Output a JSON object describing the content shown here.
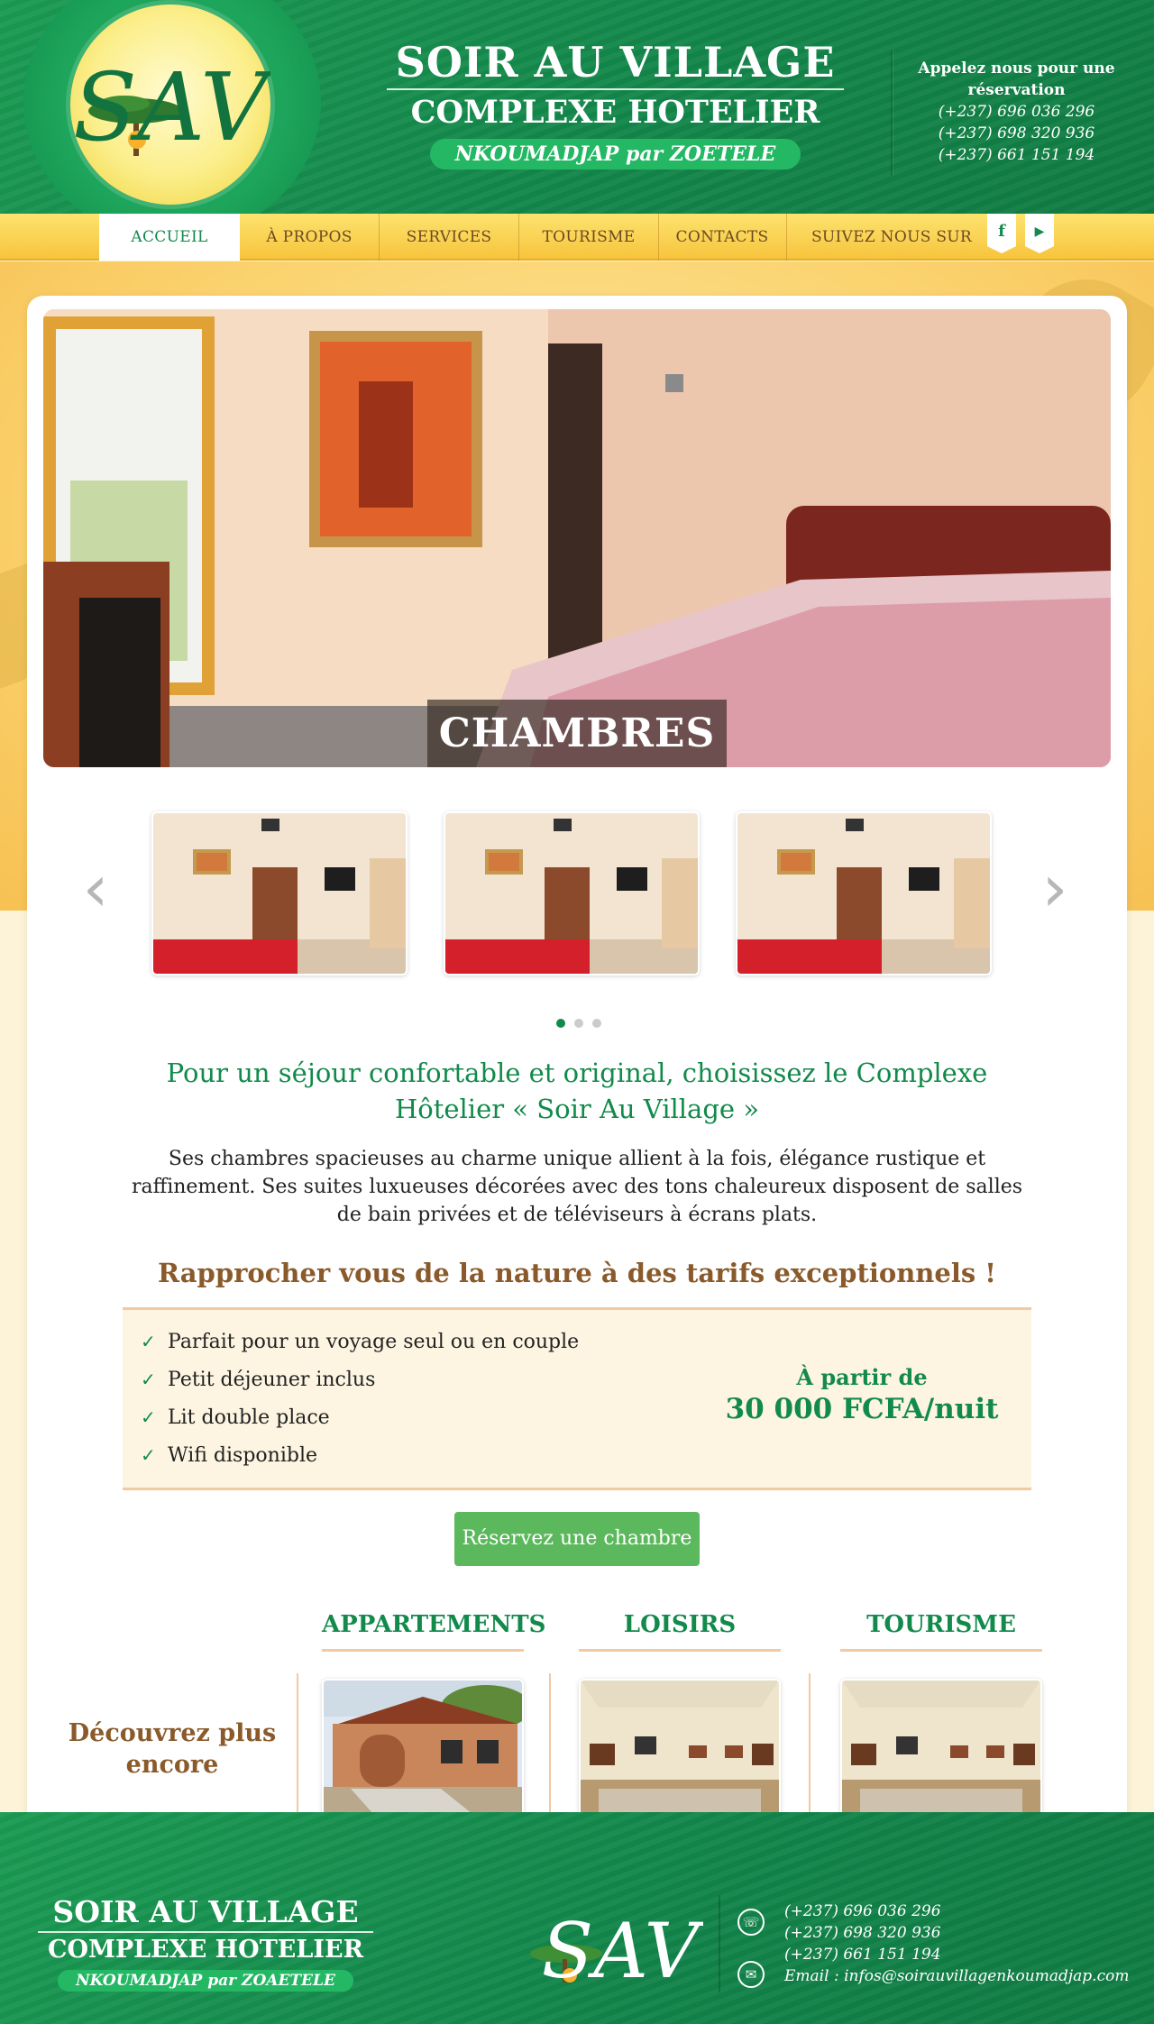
{
  "header": {
    "logo_text": "SAV",
    "title_line1": "SOIR AU VILLAGE",
    "title_line2": "COMPLEXE HOTELIER",
    "location": "NKOUMADJAP par ZOETELE",
    "call_title": "Appelez nous pour une réservation",
    "phones": [
      "(+237) 696 036 296",
      "(+237) 698 320 936",
      "(+237) 661 151 194"
    ]
  },
  "nav": {
    "items": [
      "ACCUEIL",
      "À PROPOS",
      "SERVICES",
      "TOURISME",
      "CONTACTS"
    ],
    "active_index": 0,
    "follow_label": "SUIVEZ NOUS SUR",
    "social": [
      {
        "icon": "facebook-icon",
        "glyph": "f"
      },
      {
        "icon": "youtube-icon",
        "glyph": "▶"
      }
    ]
  },
  "hero": {
    "caption": "CHAMBRES"
  },
  "carousel": {
    "prev_icon": "chevron-left-icon",
    "next_icon": "chevron-right-icon",
    "dots": 3,
    "active_dot": 0
  },
  "intro": {
    "heading": "Pour un séjour confortable et original, choisissez le Complexe Hôtelier « Soir Au Village »",
    "body": "Ses chambres spacieuses au charme unique allient à la fois, élégance rustique et raffinement. Ses suites luxueuses décorées avec des tons chaleureux disposent de salles de bain privées et de téléviseurs à écrans plats."
  },
  "promo": {
    "heading": "Rapprocher vous de la nature à des tarifs exceptionnels !",
    "features": [
      "Parfait pour un voyage seul ou en couple",
      "Petit déjeuner inclus",
      "Lit double place",
      "Wifi disponible"
    ],
    "price_label": "À partir de",
    "price_value": "30 000 FCFA/nuit",
    "button": "Réservez une chambre"
  },
  "discover": {
    "label": "Découvrez plus encore",
    "sections": [
      "APPARTEMENTS",
      "LOISIRS",
      "TOURISME"
    ]
  },
  "footer": {
    "title_line1": "SOIR AU VILLAGE",
    "title_line2": "COMPLEXE HOTELIER",
    "location": "NKOUMADJAP par ZOAETELE",
    "phones": [
      "(+237) 696 036 296",
      "(+237) 698 320 936",
      "(+237) 661 151 194"
    ],
    "email": "Email : infos@soirauvillagenkoumadjap.com"
  },
  "colors": {
    "green": "#128a4b",
    "gold": "#f7c43c",
    "brown": "#8a5a2b",
    "button": "#5cb85c"
  }
}
